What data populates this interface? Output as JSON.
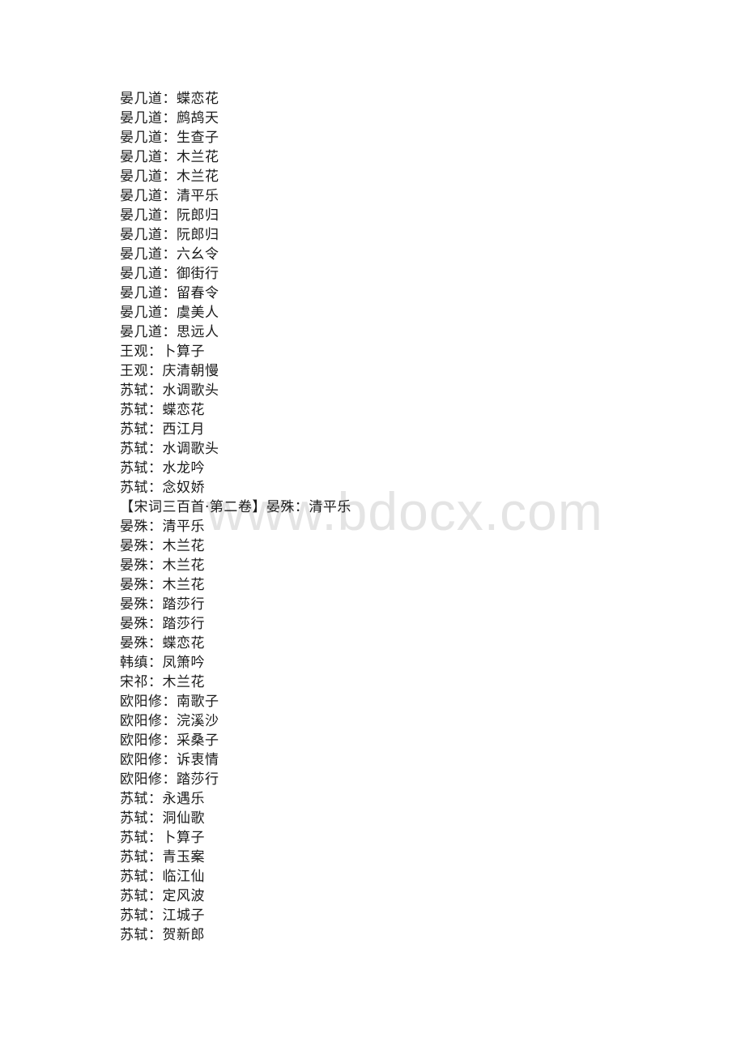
{
  "watermark": "www.bdocx.com",
  "lines": [
    "晏几道：蝶恋花",
    "晏几道：鹧鸪天",
    "晏几道：生查子",
    "晏几道：木兰花",
    "晏几道：木兰花",
    "晏几道：清平乐",
    "晏几道：阮郎归",
    "晏几道：阮郎归",
    "晏几道：六幺令",
    "晏几道：御街行",
    "晏几道：留春令",
    "晏几道：虞美人",
    "晏几道：思远人",
    "王观：卜算子",
    "王观：庆清朝慢",
    "苏轼：水调歌头",
    "苏轼：蝶恋花",
    "苏轼：西江月",
    "苏轼：水调歌头",
    "苏轼：水龙吟",
    "苏轼：念奴娇",
    "【宋词三百首·第二卷】晏殊：清平乐",
    "晏殊：清平乐",
    "晏殊：木兰花",
    "晏殊：木兰花",
    "晏殊：木兰花",
    "晏殊：踏莎行",
    "晏殊：踏莎行",
    "晏殊：蝶恋花",
    "韩缜：凤箫吟",
    "宋祁：木兰花",
    "欧阳修：南歌子",
    "欧阳修：浣溪沙",
    "欧阳修：采桑子",
    "欧阳修：诉衷情",
    "欧阳修：踏莎行",
    "苏轼：永遇乐",
    "苏轼：洞仙歌",
    "苏轼：卜算子",
    "苏轼：青玉案",
    "苏轼：临江仙",
    "苏轼：定风波",
    "苏轼：江城子",
    "苏轼：贺新郎"
  ]
}
